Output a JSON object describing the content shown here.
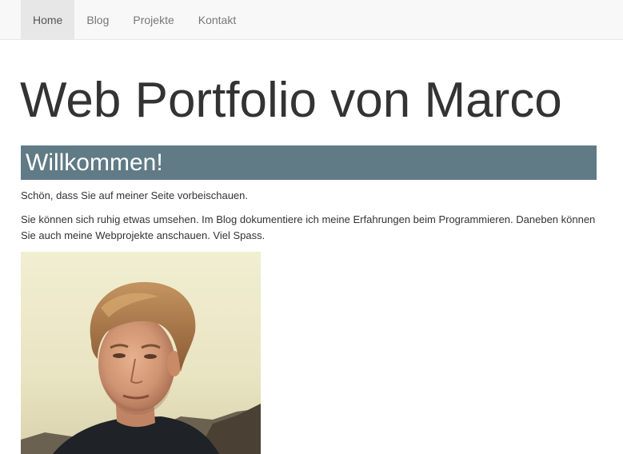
{
  "nav": {
    "items": [
      {
        "label": "Home",
        "active": true
      },
      {
        "label": "Blog",
        "active": false
      },
      {
        "label": "Projekte",
        "active": false
      },
      {
        "label": "Kontakt",
        "active": false
      }
    ]
  },
  "main": {
    "title": "Web Portfolio von Marco",
    "welcome_heading": "Willkommen!",
    "paragraph_1": "Schön, dass Sie auf meiner Seite vorbeischauen.",
    "paragraph_2": "Sie können sich ruhig etwas umsehen. Im Blog dokumentiere ich meine Erfahrungen beim Programmieren. Daneben können Sie auch meine Webprojekte anschauen. Viel Spass."
  },
  "colors": {
    "navbar_bg": "#f8f8f8",
    "nav_active_bg": "#e7e7e7",
    "welcome_bar_bg": "#607b86",
    "text": "#333333"
  }
}
